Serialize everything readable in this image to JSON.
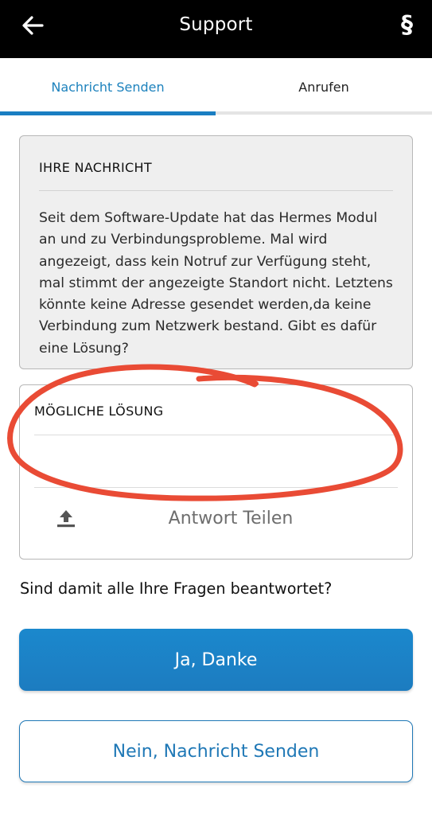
{
  "header": {
    "title": "Support",
    "back_icon": "arrow-left-icon",
    "legal_icon": "section-sign-icon",
    "legal_glyph": "§"
  },
  "tabs": [
    {
      "label": "Nachricht Senden",
      "active": true
    },
    {
      "label": "Anrufen",
      "active": false
    }
  ],
  "message_card": {
    "heading": "IHRE NACHRICHT",
    "body": "Seit dem Software-Update hat das Hermes Modul an und zu Verbindungsprobleme. Mal wird angezeigt, dass kein Notruf zur Verfügung steht, mal stimmt der angezeigte Standort nicht. Letztens könnte keine Adresse gesendet werden,da keine Verbindung zum Netzwerk bestand. Gibt es dafür eine Lösung?"
  },
  "solution_card": {
    "heading": "MÖGLICHE LÖSUNG",
    "solution_text": "",
    "share_label": "Antwort Teilen",
    "share_icon": "upload-icon"
  },
  "question": "Sind damit alle Ihre Fragen beantwortet?",
  "buttons": {
    "yes_label": "Ja, Danke",
    "no_label": "Nein, Nachricht Senden"
  },
  "colors": {
    "accent": "#1a7ec2",
    "annotation": "#e94b35"
  }
}
